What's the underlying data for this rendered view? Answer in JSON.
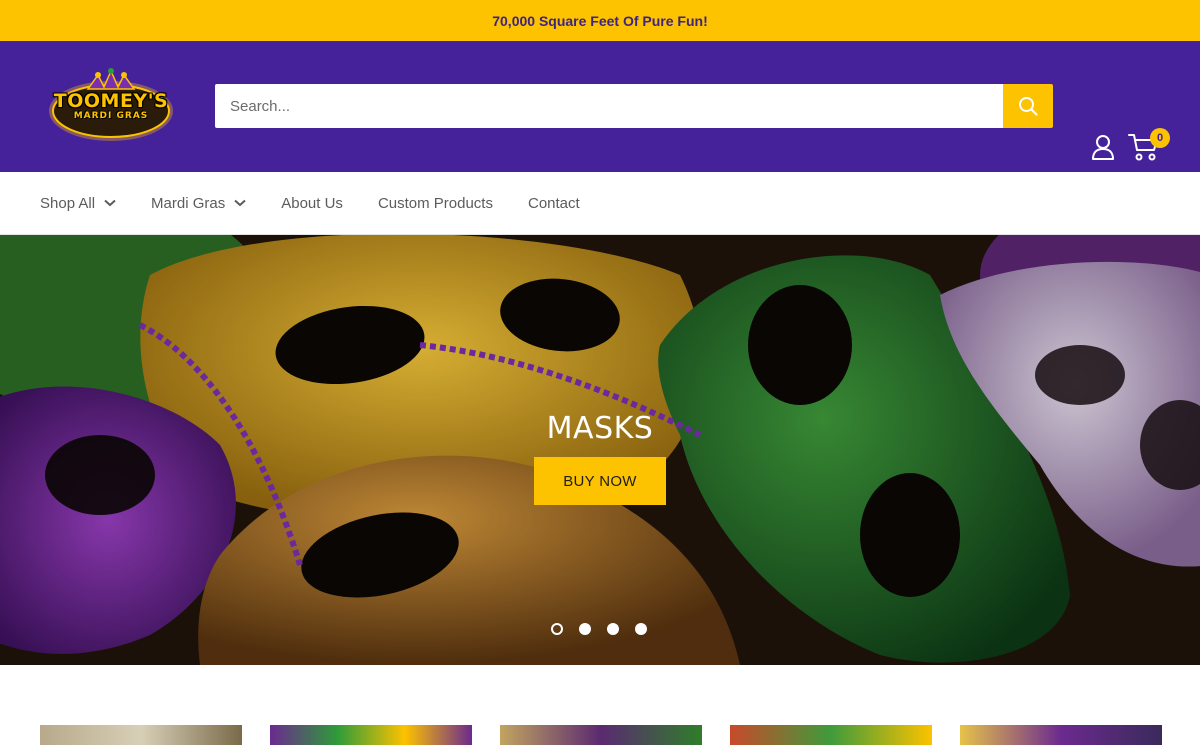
{
  "announcement": "70,000 Square Feet Of Pure Fun!",
  "logo": {
    "main": "TOOMEY'S",
    "sub": "MARDI GRAS"
  },
  "search": {
    "placeholder": "Search..."
  },
  "cart": {
    "count": "0"
  },
  "nav": [
    {
      "label": "Shop All",
      "has_dropdown": true
    },
    {
      "label": "Mardi Gras",
      "has_dropdown": true
    },
    {
      "label": "About Us",
      "has_dropdown": false
    },
    {
      "label": "Custom Products",
      "has_dropdown": false
    },
    {
      "label": "Contact",
      "has_dropdown": false
    }
  ],
  "hero": {
    "title": "MASKS",
    "button": "BUY NOW",
    "slides": 4,
    "active_slide": 1
  },
  "icons": {
    "search": "search-icon",
    "account": "user-icon",
    "cart": "cart-icon",
    "chevron": "chevron-down-icon"
  },
  "colors": {
    "accent": "#fdc200",
    "brand": "#46229a"
  }
}
